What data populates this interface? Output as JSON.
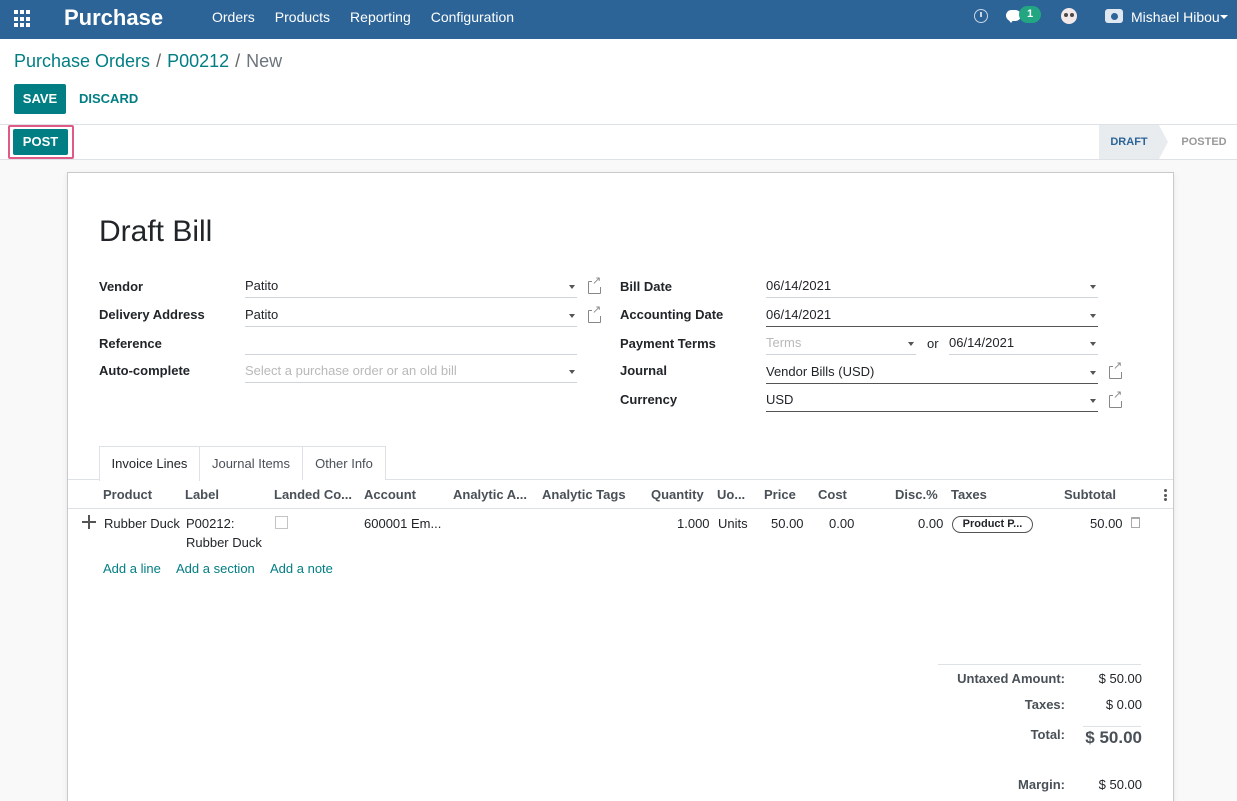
{
  "app": {
    "brand": "Purchase"
  },
  "nav": {
    "items": [
      "Orders",
      "Products",
      "Reporting",
      "Configuration"
    ]
  },
  "systray": {
    "chat_count": "1",
    "user_name": "Mishael Hibou"
  },
  "breadcrumb": {
    "items": [
      "Purchase Orders",
      "P00212",
      "New"
    ],
    "separator": "/"
  },
  "actions": {
    "save": "SAVE",
    "discard": "DISCARD",
    "post": "POST"
  },
  "status": {
    "stages": [
      "DRAFT",
      "POSTED"
    ],
    "current": "DRAFT"
  },
  "form": {
    "title": "Draft Bill",
    "left_fields": {
      "vendor": {
        "label": "Vendor",
        "value": "Patito"
      },
      "delivery_address": {
        "label": "Delivery Address",
        "value": "Patito"
      },
      "reference": {
        "label": "Reference",
        "value": ""
      },
      "auto_complete": {
        "label": "Auto-complete",
        "placeholder": "Select a purchase order or an old bill"
      }
    },
    "right_fields": {
      "bill_date": {
        "label": "Bill Date",
        "value": "06/14/2021"
      },
      "accounting_date": {
        "label": "Accounting Date",
        "value": "06/14/2021"
      },
      "payment_terms": {
        "label": "Payment Terms",
        "placeholder": "Terms",
        "or": "or",
        "due_date": "06/14/2021"
      },
      "journal": {
        "label": "Journal",
        "value": "Vendor Bills (USD)"
      },
      "currency": {
        "label": "Currency",
        "value": "USD"
      }
    }
  },
  "tabs": [
    "Invoice Lines",
    "Journal Items",
    "Other Info"
  ],
  "table": {
    "columns": [
      "Product",
      "Label",
      "Landed Co...",
      "Account",
      "Analytic A...",
      "Analytic Tags",
      "Quantity",
      "Uo...",
      "Price",
      "Cost",
      "Disc.%",
      "Taxes",
      "Subtotal"
    ],
    "rows": [
      {
        "product": "Rubber Duck",
        "label_line1": "P00212:",
        "label_line2": "Rubber Duck",
        "account": "600001 Em...",
        "quantity": "1.000",
        "uom": "Units",
        "price": "50.00",
        "cost": "0.00",
        "discount": "0.00",
        "tax": "Product P...",
        "subtotal": "50.00"
      }
    ],
    "add_links": [
      "Add a line",
      "Add a section",
      "Add a note"
    ]
  },
  "totals": {
    "untaxed_label": "Untaxed Amount:",
    "untaxed_value": "$ 50.00",
    "taxes_label": "Taxes:",
    "taxes_value": "$ 0.00",
    "total_label": "Total:",
    "total_value": "$ 50.00",
    "margin_label": "Margin:",
    "margin_value": "$ 50.00"
  },
  "colors": {
    "navbar": "#2c6497",
    "primary": "#017e84",
    "highlight": "#e05a87",
    "badge": "#21a681"
  },
  "icons": [
    "apps-grid-icon",
    "clock-icon",
    "chat-icon",
    "owl-avatar-icon",
    "camera-icon",
    "caret-down-icon",
    "external-link-icon",
    "drag-handle-icon",
    "trash-icon",
    "kebab-icon"
  ]
}
